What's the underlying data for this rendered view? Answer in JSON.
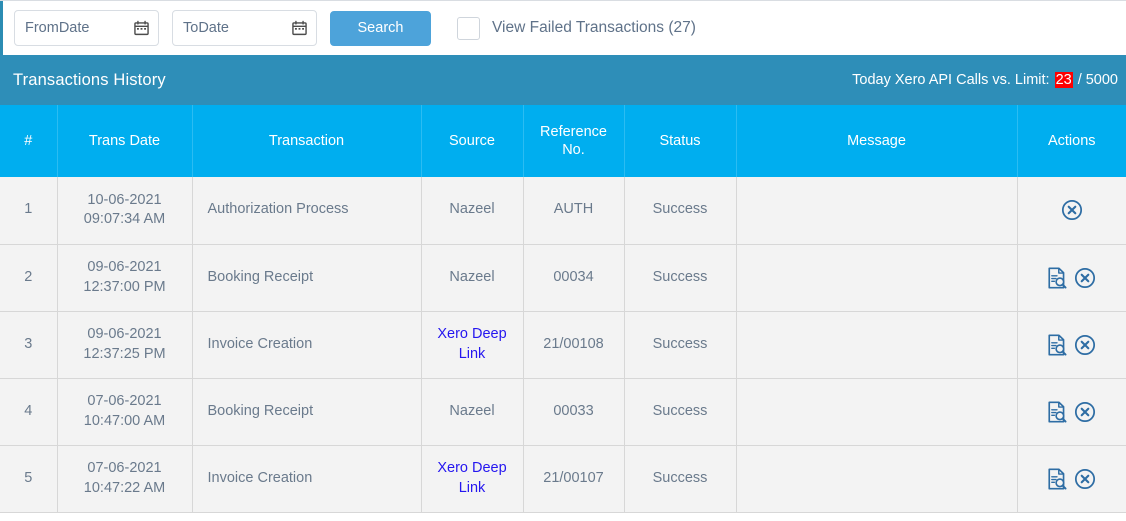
{
  "toolbar": {
    "from_date": {
      "value": "",
      "placeholder": "FromDate",
      "icon": "calendar-icon"
    },
    "to_date": {
      "value": "",
      "placeholder": "ToDate",
      "icon": "calendar-icon"
    },
    "search_label": "Search",
    "failed_checkbox": {
      "label": "View Failed Transactions (27)",
      "checked": false
    }
  },
  "panel": {
    "title": "Transactions History",
    "api_counter": {
      "label": "Today Xero API Calls vs. Limit:",
      "used": "23",
      "separator": "/",
      "limit": "5000",
      "used_bg": "#ff0000",
      "used_color": "#ffffff"
    }
  },
  "table": {
    "columns": [
      "#",
      "Trans Date",
      "Transaction",
      "Source",
      "Reference No.",
      "Status",
      "Message",
      "Actions"
    ],
    "rows": [
      {
        "num": "1",
        "date": "10-06-2021",
        "time": "09:07:34 AM",
        "transaction": "Authorization Process",
        "source": "Nazeel",
        "source_is_link": false,
        "reference": "AUTH",
        "status": "Success",
        "message": "",
        "actions": [
          "cancel-circle-icon"
        ]
      },
      {
        "num": "2",
        "date": "09-06-2021",
        "time": "12:37:00 PM",
        "transaction": "Booking Receipt",
        "source": "Nazeel",
        "source_is_link": false,
        "reference": "00034",
        "status": "Success",
        "message": "",
        "actions": [
          "document-search-icon",
          "cancel-circle-icon"
        ]
      },
      {
        "num": "3",
        "date": "09-06-2021",
        "time": "12:37:25 PM",
        "transaction": "Invoice Creation",
        "source": "Xero Deep Link",
        "source_is_link": true,
        "reference": "21/00108",
        "status": "Success",
        "message": "",
        "actions": [
          "document-search-icon",
          "cancel-circle-icon"
        ]
      },
      {
        "num": "4",
        "date": "07-06-2021",
        "time": "10:47:00 AM",
        "transaction": "Booking Receipt",
        "source": "Nazeel",
        "source_is_link": false,
        "reference": "00033",
        "status": "Success",
        "message": "",
        "actions": [
          "document-search-icon",
          "cancel-circle-icon"
        ]
      },
      {
        "num": "5",
        "date": "07-06-2021",
        "time": "10:47:22 AM",
        "transaction": "Invoice Creation",
        "source": "Xero Deep Link",
        "source_is_link": true,
        "reference": "21/00107",
        "status": "Success",
        "message": "",
        "actions": [
          "document-search-icon",
          "cancel-circle-icon"
        ]
      }
    ]
  },
  "colors": {
    "panel_header_bg": "#2e8eb8",
    "table_header_bg": "#00aeef",
    "row_bg": "#f3f3f3",
    "primary_button": "#4da3da",
    "link": "#2516f0",
    "icon": "#2e6da4",
    "text": "#6a7a8c"
  }
}
